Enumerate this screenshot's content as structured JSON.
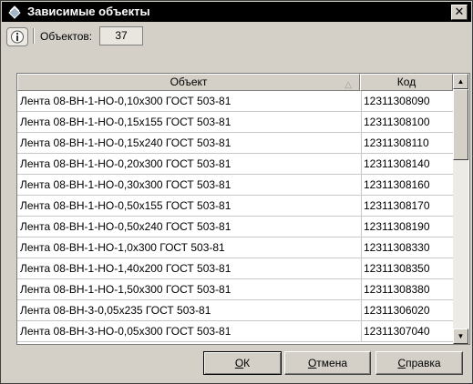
{
  "window": {
    "title": "Зависимые объекты",
    "close_glyph": "✕"
  },
  "toolbar": {
    "info_icon": "info-icon",
    "count_label": "Объектов:",
    "count_value": "37"
  },
  "table": {
    "columns": [
      {
        "label": "Объект",
        "sort": "ascending"
      },
      {
        "label": "Код"
      }
    ],
    "rows": [
      {
        "object": "Лента 08-ВН-1-НО-0,10х300 ГОСТ 503-81",
        "code": "12311308090"
      },
      {
        "object": "Лента 08-ВН-1-НО-0,15х155 ГОСТ 503-81",
        "code": "12311308100"
      },
      {
        "object": "Лента 08-ВН-1-НО-0,15х240 ГОСТ 503-81",
        "code": "12311308110"
      },
      {
        "object": "Лента 08-ВН-1-НО-0,20х300 ГОСТ 503-81",
        "code": "12311308140"
      },
      {
        "object": "Лента 08-ВН-1-НО-0,30х300 ГОСТ 503-81",
        "code": "12311308160"
      },
      {
        "object": "Лента 08-ВН-1-НО-0,50х155 ГОСТ 503-81",
        "code": "12311308170"
      },
      {
        "object": "Лента 08-ВН-1-НО-0,50х240 ГОСТ 503-81",
        "code": "12311308190"
      },
      {
        "object": "Лента 08-ВН-1-НО-1,0х300 ГОСТ 503-81",
        "code": "12311308330"
      },
      {
        "object": "Лента 08-ВН-1-НО-1,40х200 ГОСТ 503-81",
        "code": "12311308350"
      },
      {
        "object": "Лента 08-ВН-1-НО-1,50х300 ГОСТ 503-81",
        "code": "12311308380"
      },
      {
        "object": "Лента 08-ВН-3-0,05х235 ГОСТ 503-81",
        "code": "12311306020"
      },
      {
        "object": "Лента 08-ВН-3-НО-0,05х300 ГОСТ 503-81",
        "code": "12311307040"
      }
    ]
  },
  "buttons": {
    "ok": {
      "accel": "О",
      "rest": "К"
    },
    "cancel": {
      "accel": "О",
      "rest": "тмена"
    },
    "help": {
      "accel": "С",
      "rest": "правка"
    }
  }
}
